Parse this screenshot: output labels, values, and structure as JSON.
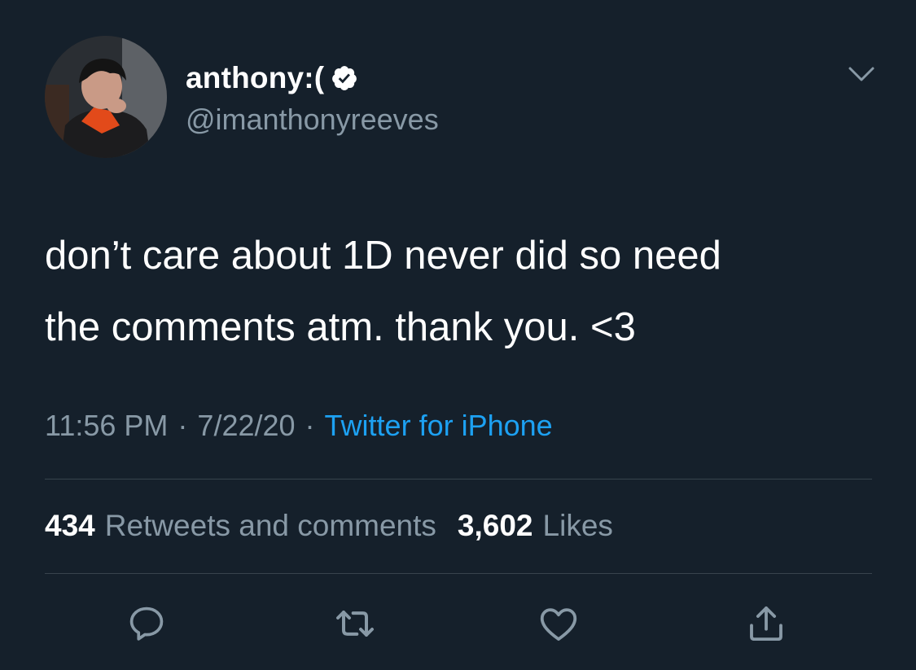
{
  "author": {
    "display_name": "anthony:(",
    "handle": "@imanthonyreeves",
    "verified": true
  },
  "tweet": {
    "text": "don’t care about 1D never did so need\nthe comments atm. thank you. <3",
    "time": "11:56 PM",
    "date": "7/22/20",
    "separator": "·",
    "source": "Twitter for iPhone"
  },
  "stats": {
    "retweets_count": "434",
    "retweets_label": "Retweets and comments",
    "likes_count": "3,602",
    "likes_label": "Likes"
  },
  "icons": {
    "reply": "speech-bubble-icon",
    "retweet": "retweet-arrows-icon",
    "like": "heart-icon",
    "share": "share-upload-icon",
    "menu": "chevron-down-icon"
  },
  "colors": {
    "background": "#15202b",
    "text_primary": "#ffffff",
    "text_secondary": "#8899a6",
    "link": "#1da1f2",
    "divider": "#38444d"
  }
}
